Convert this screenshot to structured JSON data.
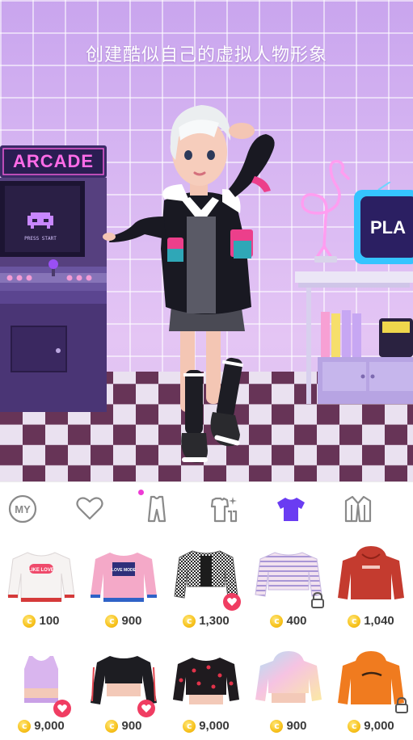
{
  "scene": {
    "title": "创建酷似自己的虚拟人物形象",
    "arcade_marquee": "ARCADE",
    "arcade_screen_text": "PRESS START",
    "tv_text": "PLA"
  },
  "tabs": [
    {
      "name": "my",
      "label": "MY",
      "icon": "my-icon"
    },
    {
      "name": "favorites",
      "icon": "heart-outline-icon"
    },
    {
      "name": "outfits",
      "icon": "jumpsuit-icon",
      "new_dot": true
    },
    {
      "name": "coordinate",
      "icon": "outfit-sparkle-icon"
    },
    {
      "name": "tops",
      "icon": "tshirt-icon",
      "selected": true
    },
    {
      "name": "outerwear",
      "icon": "jacket-icon"
    }
  ],
  "colors": {
    "accent": "#6a3cf2",
    "tab_icon": "#8a8a8a",
    "heart_badge": "#f03d62",
    "new_dot": "#ee3ad5",
    "coin": "#f7c21c"
  },
  "items": [
    {
      "name": "white-like-love-sweater",
      "price": "100",
      "badge": "",
      "print": "LIKE LOVE"
    },
    {
      "name": "pink-love-mode-sweater",
      "price": "900",
      "badge": "",
      "print": "LOVE MODE"
    },
    {
      "name": "houndstooth-crop-jacket",
      "price": "1,300",
      "badge": "heart"
    },
    {
      "name": "striped-crop-top",
      "price": "400",
      "badge": "lock"
    },
    {
      "name": "red-hoodie",
      "price": "1,040",
      "badge": ""
    },
    {
      "name": "lilac-crop-tank",
      "price": "9,000",
      "badge": "heart"
    },
    {
      "name": "black-crop-jacket",
      "price": "900",
      "badge": "heart"
    },
    {
      "name": "cherry-print-sweater",
      "price": "9,000",
      "badge": ""
    },
    {
      "name": "tie-dye-hoodie",
      "price": "900",
      "badge": ""
    },
    {
      "name": "orange-hoodie",
      "price": "9,000",
      "badge": "lock"
    }
  ]
}
